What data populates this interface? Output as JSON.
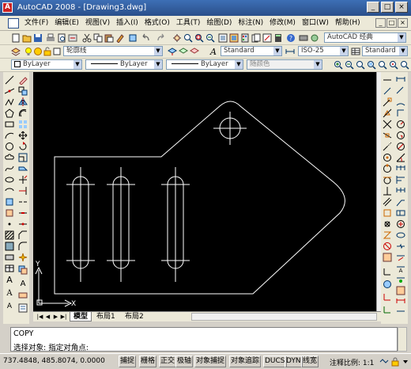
{
  "window": {
    "title": "AutoCAD 2008 - [Drawing3.dwg]",
    "app_icon_label": "A",
    "controls": [
      "_",
      "□",
      "×"
    ]
  },
  "menubar": {
    "items": [
      "文件(F)",
      "编辑(E)",
      "视图(V)",
      "插入(I)",
      "格式(O)",
      "工具(T)",
      "绘图(D)",
      "标注(N)",
      "修改(M)",
      "窗口(W)",
      "帮助(H)"
    ],
    "mdi_controls": [
      "_",
      "□",
      "×"
    ]
  },
  "toolbar1": {
    "workspace": "AutoCAD 经典"
  },
  "toolbar2": {
    "layer": "轮廓线",
    "text_style": "Standard",
    "dim_style": "ISO-25",
    "table_style": "Standard"
  },
  "toolbar3": {
    "color": "ByLayer",
    "linetype": "ByLayer",
    "lineweight": "ByLayer",
    "plot_style": "随颜色"
  },
  "tabs": {
    "items": [
      "模型",
      "布局1",
      "布局2"
    ],
    "active_index": 0
  },
  "command": {
    "history": "COPY",
    "prompt": "选择对象: 指定对角点:"
  },
  "ucs": {
    "x_label": "X",
    "y_label": "Y"
  },
  "status": {
    "coordinates": "737.4848, 485.8074, 0.0000",
    "toggles": [
      "捕捉",
      "栅格",
      "正交",
      "极轴",
      "对象捕捉",
      "对象追踪",
      "DUCS",
      "DYN",
      "线宽"
    ],
    "annotation_scale": "注释比例: 1:1"
  }
}
